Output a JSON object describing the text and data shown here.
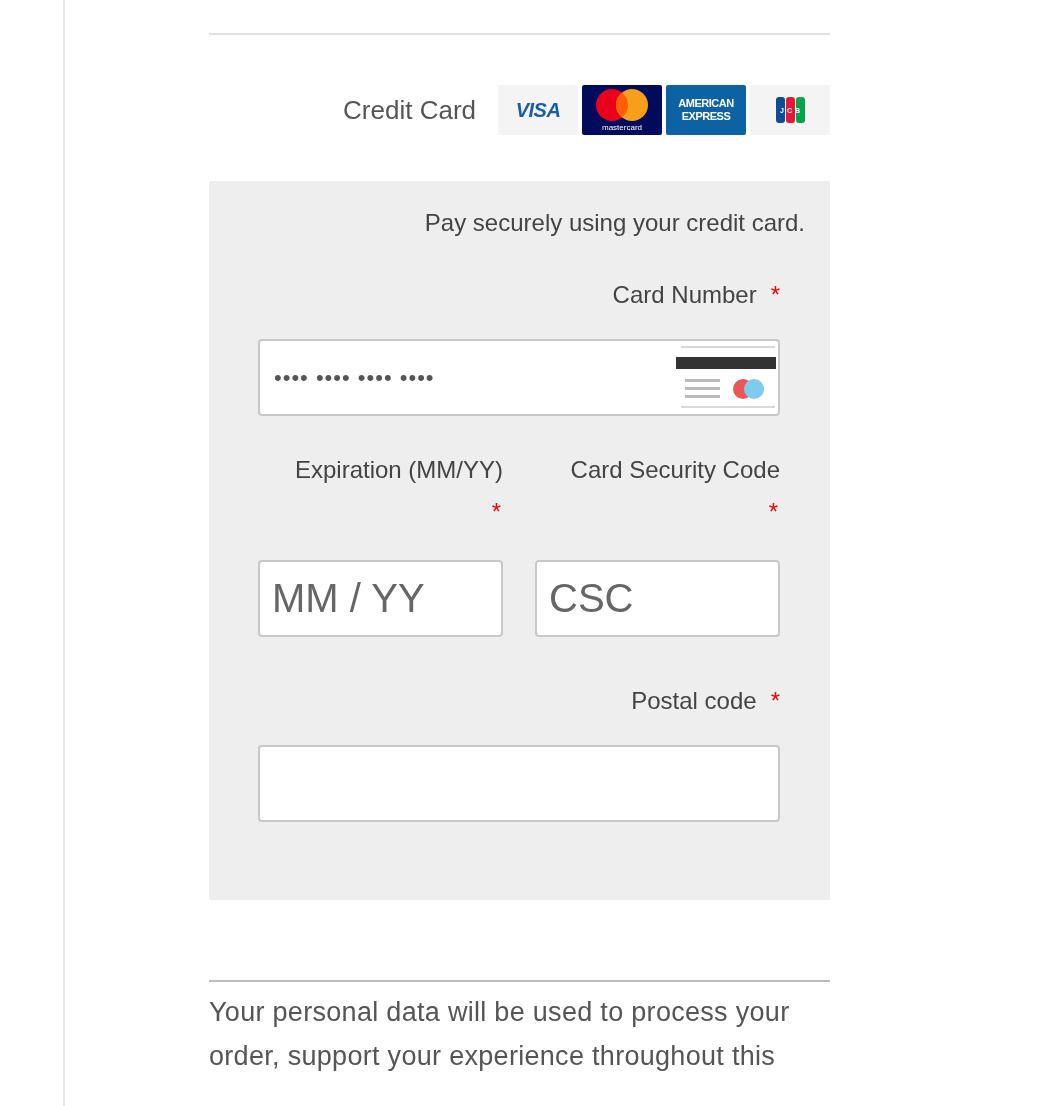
{
  "payment_method": {
    "label": "Credit Card",
    "brands": [
      {
        "kind": "visa",
        "label": "VISA"
      },
      {
        "kind": "mastercard",
        "label": "mastercard"
      },
      {
        "kind": "amex",
        "label": "AMERICAN EXPRESS"
      },
      {
        "kind": "jcb",
        "label": "JCB"
      }
    ]
  },
  "card_form": {
    "intro": "Pay securely using your credit card.",
    "required_mark": "*",
    "fields": [
      {
        "kind": "card_number",
        "label": "Card Number",
        "required": true,
        "placeholder": "•••• •••• •••• ••••"
      },
      {
        "kind": "half",
        "label": "Expiration (MM/YY)",
        "required": true,
        "placeholder": "MM / YY"
      },
      {
        "kind": "half",
        "label": "Card Security Code",
        "required": true,
        "placeholder": "CSC"
      },
      {
        "kind": "full",
        "label": "Postal code",
        "required": true
      }
    ]
  },
  "privacy_notice": "Your personal data will be used to process your order, support your experience throughout this"
}
